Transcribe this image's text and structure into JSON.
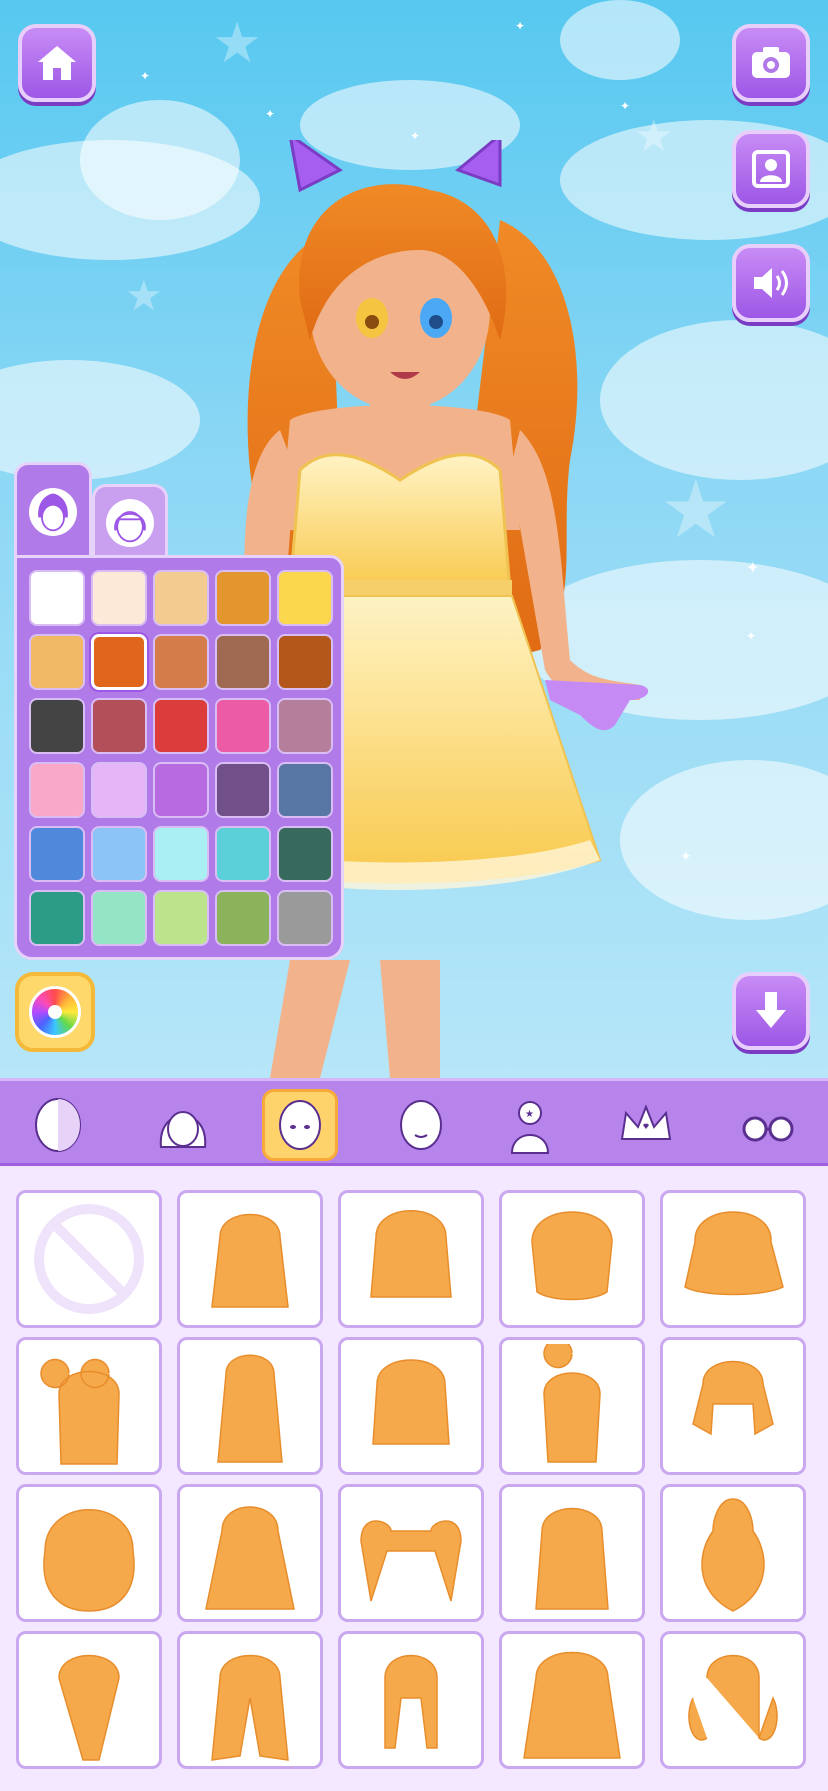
{
  "toolbar": {
    "home_icon": "home-icon",
    "camera_icon": "camera-icon",
    "profile_icon": "portrait-icon",
    "sound_icon": "speaker-icon",
    "download_icon": "arrow-down-icon"
  },
  "palette": {
    "tabs": [
      "hair-color-tab",
      "bangs-color-tab"
    ],
    "selected_index": 6,
    "colors": [
      "#ffffff",
      "#fde9d7",
      "#f3cb90",
      "#e2962d",
      "#fbd74e",
      "#f1b866",
      "#df661a",
      "#d57d4a",
      "#9f6a51",
      "#b3571a",
      "#444444",
      "#b24f59",
      "#dc3d3b",
      "#ec5ca6",
      "#b57f9c",
      "#f9a8c8",
      "#e6b5f7",
      "#b86ae0",
      "#715089",
      "#5876a4",
      "#5089db",
      "#8cc4f7",
      "#a9eff3",
      "#5cd0d9",
      "#376a5d",
      "#2d9c86",
      "#93e5c6",
      "#bce48d",
      "#8ab35c",
      "#9a9a9a"
    ]
  },
  "categories": [
    {
      "name": "skin",
      "active": false
    },
    {
      "name": "hair",
      "active": false
    },
    {
      "name": "face",
      "active": true
    },
    {
      "name": "expression",
      "active": false
    },
    {
      "name": "tattoo",
      "active": false
    },
    {
      "name": "crown",
      "active": false
    },
    {
      "name": "glasses",
      "active": false
    }
  ],
  "items": {
    "selected_index": null,
    "count": 20,
    "first_item": "none"
  },
  "colors": {
    "accent": "#b784ec",
    "hair_item": "#f5a94a",
    "highlight": "#ffd36b"
  }
}
